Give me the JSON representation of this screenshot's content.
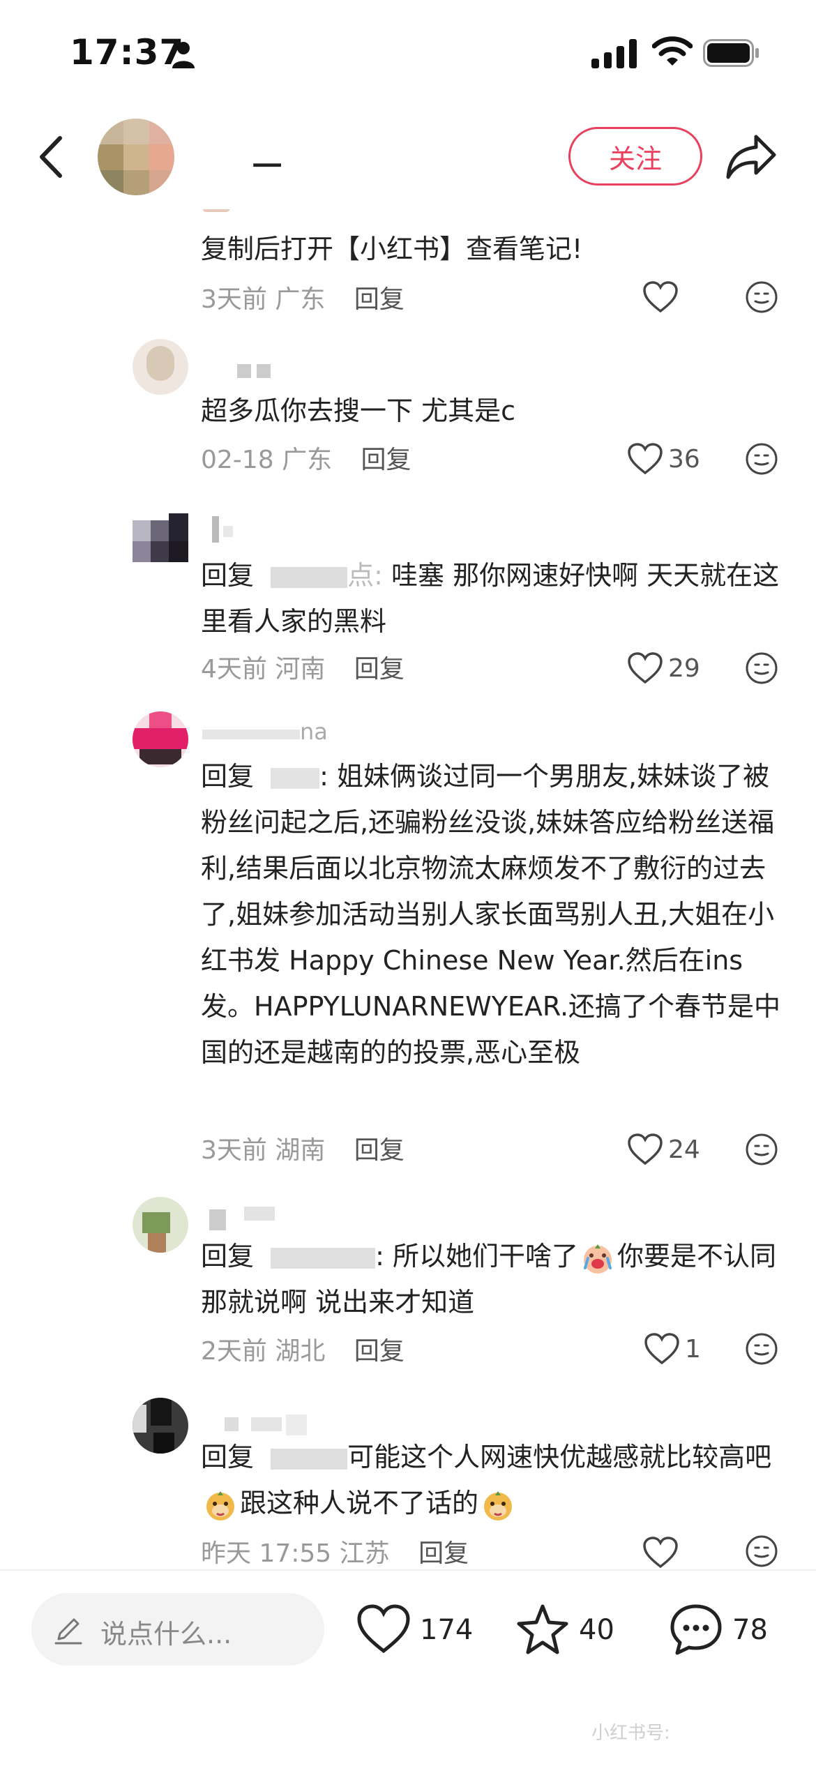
{
  "status_bar": {
    "time": "17:37"
  },
  "header": {
    "user_name": "一",
    "follow_label": "关注"
  },
  "comments": [
    {
      "text": "复制后打开【小红书】查看笔记!",
      "meta_time": "3天前",
      "meta_location": "广东",
      "reply_label": "回复",
      "likes": ""
    },
    {
      "text": "超多瓜你去搜一下 尤其是c",
      "meta_time": "02-18",
      "meta_location": "广东",
      "reply_label": "回复",
      "likes": "36"
    },
    {
      "prefix": "回复",
      "name_tail": "点:",
      "text": " 哇塞 那你网速好快啊 天天就在这里看人家的黑料",
      "meta_time": "4天前",
      "meta_location": "河南",
      "reply_label": "回复",
      "likes": "29"
    },
    {
      "name_tail": "na",
      "prefix": "回复",
      "name_colon": ":",
      "text": " 姐妹俩谈过同一个男朋友,妹妹谈了被粉丝问起之后,还骗粉丝没谈,妹妹答应给粉丝送福利,结果后面以北京物流太麻烦发不了敷衍的过去了,姐妹参加活动当别人家长面骂别人丑,大姐在小红书发 Happy Chinese New Year.然后在ins发。HAPPYLUNARNEWYEAR.还搞了个春节是中国的还是越南的的投票,恶心至极",
      "meta_time": "3天前",
      "meta_location": "湖南",
      "reply_label": "回复",
      "likes": "24"
    },
    {
      "prefix": "回复",
      "name_colon": ":",
      "text_a": " 所以她们干啥了",
      "text_b": "你要是不认同那就说啊 说出来才知道",
      "meta_time": "2天前",
      "meta_location": "湖北",
      "reply_label": "回复",
      "likes": "1"
    },
    {
      "prefix": "回复",
      "text_a": "可能这个人网速快优越感就比较高吧",
      "text_b": "跟这种人说不了话的",
      "meta_time": "昨天 17:55",
      "meta_location": "江苏",
      "reply_label": "回复",
      "likes": ""
    }
  ],
  "bottom_bar": {
    "input_placeholder": "说点什么...",
    "like_count": "174",
    "star_count": "40",
    "comment_count": "78",
    "watermark": "小红书号:"
  },
  "colors": {
    "accent": "#e8405d",
    "meta": "#999999"
  }
}
